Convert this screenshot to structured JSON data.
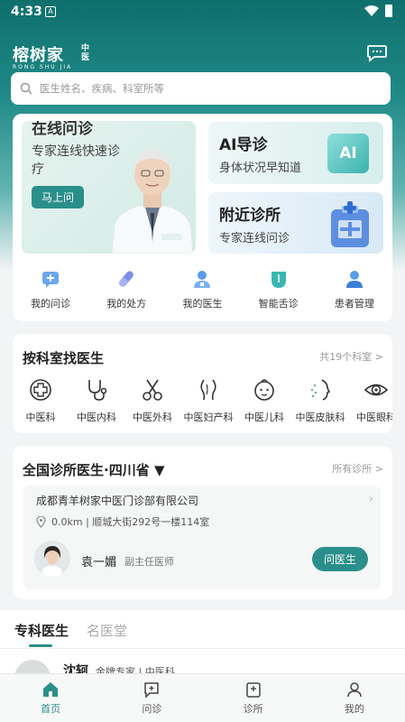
{
  "status_bar": {
    "time": "4:33",
    "notif": "A"
  },
  "brand": {
    "name": "榕树家",
    "sub": "RONG SHU JIA",
    "tag": "中医"
  },
  "search": {
    "placeholder": "医生姓名、疾病、科室所等"
  },
  "consult": {
    "title": "在线问诊",
    "desc": "专家连线快速诊疗",
    "button": "马上问"
  },
  "ai_guide": {
    "title": "AI导诊",
    "desc": "身体状况早知道",
    "badge": "AI"
  },
  "nearby": {
    "title": "附近诊所",
    "desc": "专家连线问诊"
  },
  "quick_actions": [
    {
      "label": "我的问诊",
      "icon": "consult-icon"
    },
    {
      "label": "我的处方",
      "icon": "pill-icon"
    },
    {
      "label": "我的医生",
      "icon": "doctor-icon"
    },
    {
      "label": "智能舌诊",
      "icon": "tongue-icon"
    },
    {
      "label": "患者管理",
      "icon": "patient-icon"
    }
  ],
  "departments": {
    "title": "按科室找医生",
    "more": "共19个科室 >",
    "items": [
      {
        "label": "中医科",
        "icon": "medical-cross-icon"
      },
      {
        "label": "中医内科",
        "icon": "stethoscope-icon"
      },
      {
        "label": "中医外科",
        "icon": "scissors-icon"
      },
      {
        "label": "中医妇产科",
        "icon": "uterus-icon"
      },
      {
        "label": "中医儿科",
        "icon": "baby-icon"
      },
      {
        "label": "中医皮肤科",
        "icon": "face-icon"
      },
      {
        "label": "中医眼科",
        "icon": "eye-icon"
      }
    ]
  },
  "clinics": {
    "title": "全国诊所医生·四川省",
    "more": "所有诊所 >",
    "clinic_name": "成都青羊树家中医门诊部有限公司",
    "address": "0.0km | 顺城大街292号一楼114室",
    "doctor_name": "袁一媚",
    "doctor_title": "副主任医师",
    "ask_button": "问医生"
  },
  "doctor_tabs": [
    {
      "label": "专科医生",
      "active": true
    },
    {
      "label": "名医堂",
      "active": false
    }
  ],
  "peek_doctor": {
    "name": "沈轲",
    "tag": "金牌专家 | 中医科"
  },
  "bottom_nav": [
    {
      "label": "首页",
      "active": true
    },
    {
      "label": "问诊",
      "active": false
    },
    {
      "label": "诊所",
      "active": false
    },
    {
      "label": "我的",
      "active": false
    }
  ],
  "colors": {
    "accent": "#2a8f8a",
    "header_dark": "#0f6f6d"
  }
}
